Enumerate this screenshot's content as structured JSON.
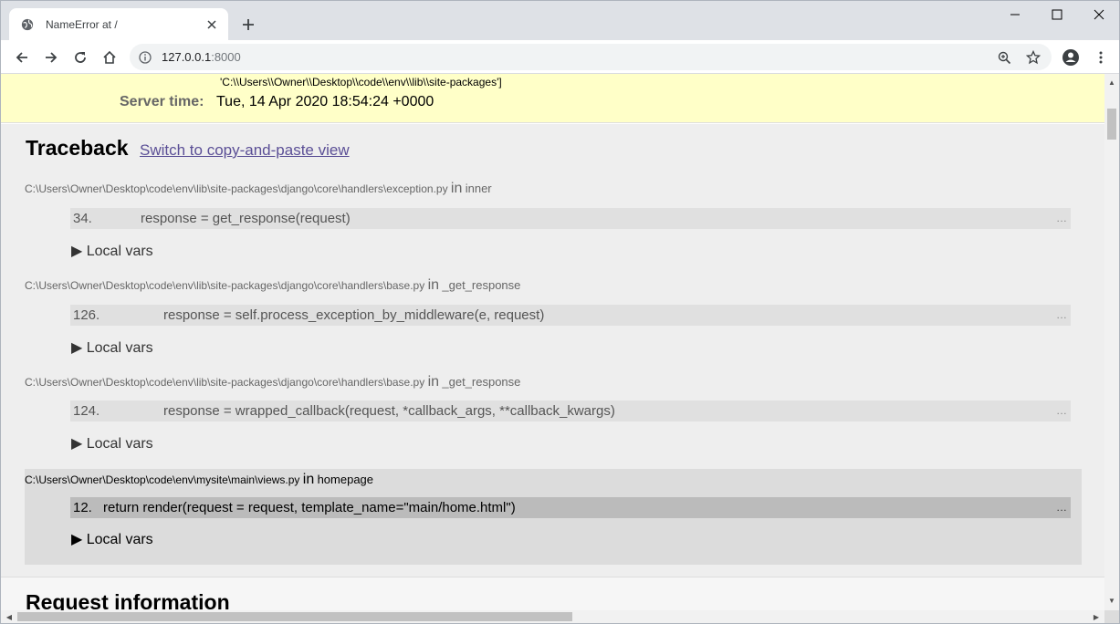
{
  "browser": {
    "tab_title": "NameError at /",
    "url_host": "127.0.0.1",
    "url_port": ":8000"
  },
  "summary": {
    "path_tail": "'C:\\\\Users\\\\Owner\\\\Desktop\\\\code\\\\env\\\\lib\\\\site-packages']",
    "server_time_label": "Server time:",
    "server_time_value": "Tue, 14 Apr 2020 18:54:24 +0000"
  },
  "traceback": {
    "heading": "Traceback",
    "switch_link": "Switch to copy-and-paste view",
    "in_word": "in",
    "local_vars_label": "▶ Local vars",
    "ellipsis": "…",
    "frames": [
      {
        "file": "C:\\Users\\Owner\\Desktop\\code\\env\\lib\\site-packages\\django\\core\\handlers\\exception.py",
        "func": "inner",
        "line_num": "34.",
        "code": "response = get_response(request)"
      },
      {
        "file": "C:\\Users\\Owner\\Desktop\\code\\env\\lib\\site-packages\\django\\core\\handlers\\base.py",
        "func": "_get_response",
        "line_num": "126.",
        "code": "response = self.process_exception_by_middleware(e, request)"
      },
      {
        "file": "C:\\Users\\Owner\\Desktop\\code\\env\\lib\\site-packages\\django\\core\\handlers\\base.py",
        "func": "_get_response",
        "line_num": "124.",
        "code": "response = wrapped_callback(request, *callback_args, **callback_kwargs)"
      },
      {
        "file": "C:\\Users\\Owner\\Desktop\\code\\env\\mysite\\main\\views.py",
        "func": "homepage",
        "line_num": "12.",
        "code": "return render(request = request, template_name=\"main/home.html\")"
      }
    ]
  },
  "request_info": {
    "heading": "Request information"
  },
  "icons": {
    "favicon": "globe-icon",
    "close": "close-icon",
    "new_tab": "plus-icon",
    "minimize": "minimize-icon",
    "maximize": "maximize-icon",
    "window_close": "close-icon",
    "back": "back-arrow-icon",
    "forward": "forward-arrow-icon",
    "reload": "reload-icon",
    "home": "home-icon",
    "info": "info-icon",
    "zoom": "zoom-icon",
    "star": "star-icon",
    "profile": "profile-icon",
    "menu": "kebab-menu-icon"
  }
}
